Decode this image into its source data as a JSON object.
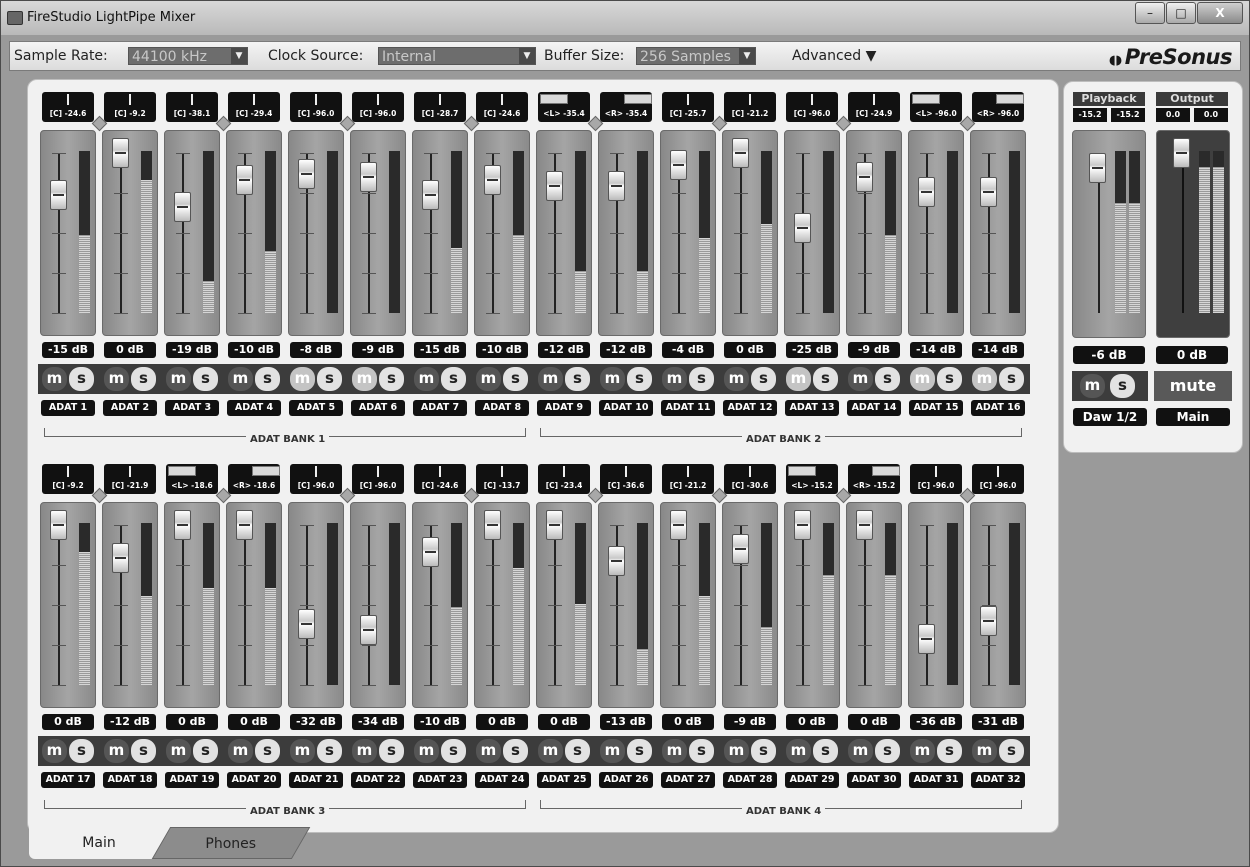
{
  "window": {
    "title": "FireStudio LightPipe Mixer",
    "minimize_label": "–",
    "maximize_label": "□",
    "close_label": "X"
  },
  "toolbar": {
    "sample_rate_label": "Sample Rate:",
    "sample_rate_value": "44100 kHz",
    "clock_source_label": "Clock Source:",
    "clock_source_value": "Internal",
    "buffer_size_label": "Buffer Size:",
    "buffer_size_value": "256 Samples",
    "advanced_label": "Advanced",
    "brand": "PreSonus"
  },
  "mute_label": "m",
  "solo_label": "s",
  "banks": [
    {
      "label": "ADAT BANK 1",
      "channels": [
        {
          "name": "ADAT 1",
          "pan": "[C] -24.6",
          "gain": "-15 dB",
          "level": 0.72,
          "meter": 0.48,
          "highlight": false
        },
        {
          "name": "ADAT 2",
          "pan": "[C] -9.2",
          "gain": "0 dB",
          "level": 1.0,
          "meter": 0.82,
          "highlight": false
        },
        {
          "name": "ADAT 3",
          "pan": "[C] -38.1",
          "gain": "-19 dB",
          "level": 0.64,
          "meter": 0.2,
          "highlight": false
        },
        {
          "name": "ADAT 4",
          "pan": "[C] -29.4",
          "gain": "-10 dB",
          "level": 0.82,
          "meter": 0.38,
          "highlight": false
        }
      ],
      "channels2": [
        {
          "name": "ADAT 5",
          "pan": "[C] -96.0",
          "gain": "-8 dB",
          "level": 0.86,
          "meter": 0.0,
          "highlight": true
        },
        {
          "name": "ADAT 6",
          "pan": "[C] -96.0",
          "gain": "-9 dB",
          "level": 0.84,
          "meter": 0.0,
          "highlight": true
        },
        {
          "name": "ADAT 7",
          "pan": "[C] -28.7",
          "gain": "-15 dB",
          "level": 0.72,
          "meter": 0.4,
          "highlight": false
        },
        {
          "name": "ADAT 8",
          "pan": "[C] -24.6",
          "gain": "-10 dB",
          "level": 0.82,
          "meter": 0.48,
          "highlight": false
        }
      ]
    },
    {
      "label": "ADAT BANK 2",
      "channels": [
        {
          "name": "ADAT 9",
          "pan": "<L> -35.4",
          "gain": "-12 dB",
          "level": 0.78,
          "meter": 0.26,
          "highlight": false,
          "stereo": "L"
        },
        {
          "name": "ADAT 10",
          "pan": "<R> -35.4",
          "gain": "-12 dB",
          "level": 0.78,
          "meter": 0.26,
          "highlight": false,
          "stereo": "R"
        },
        {
          "name": "ADAT 11",
          "pan": "[C] -25.7",
          "gain": "-4 dB",
          "level": 0.92,
          "meter": 0.46,
          "highlight": false
        },
        {
          "name": "ADAT 12",
          "pan": "[C] -21.2",
          "gain": "0 dB",
          "level": 1.0,
          "meter": 0.55,
          "highlight": false
        }
      ],
      "channels2": [
        {
          "name": "ADAT 13",
          "pan": "[C] -96.0",
          "gain": "-25 dB",
          "level": 0.5,
          "meter": 0.0,
          "highlight": true
        },
        {
          "name": "ADAT 14",
          "pan": "[C] -24.9",
          "gain": "-9 dB",
          "level": 0.84,
          "meter": 0.48,
          "highlight": false
        },
        {
          "name": "ADAT 15",
          "pan": "<L> -96.0",
          "gain": "-14 dB",
          "level": 0.74,
          "meter": 0.0,
          "highlight": true,
          "stereo": "L"
        },
        {
          "name": "ADAT 16",
          "pan": "<R> -96.0",
          "gain": "-14 dB",
          "level": 0.74,
          "meter": 0.0,
          "highlight": true,
          "stereo": "R"
        }
      ]
    },
    {
      "label": "ADAT BANK 3",
      "channels": [
        {
          "name": "ADAT 17",
          "pan": "[C] -9.2",
          "gain": "0 dB",
          "level": 1.0,
          "meter": 0.82,
          "highlight": false
        },
        {
          "name": "ADAT 18",
          "pan": "[C] -21.9",
          "gain": "-12 dB",
          "level": 0.78,
          "meter": 0.55,
          "highlight": false
        },
        {
          "name": "ADAT 19",
          "pan": "<L> -18.6",
          "gain": "0 dB",
          "level": 1.0,
          "meter": 0.6,
          "highlight": false,
          "stereo": "L"
        },
        {
          "name": "ADAT 20",
          "pan": "<R> -18.6",
          "gain": "0 dB",
          "level": 1.0,
          "meter": 0.6,
          "highlight": false,
          "stereo": "R"
        }
      ],
      "channels2": [
        {
          "name": "ADAT 21",
          "pan": "[C] -96.0",
          "gain": "-32 dB",
          "level": 0.34,
          "meter": 0.0,
          "highlight": false
        },
        {
          "name": "ADAT 22",
          "pan": "[C] -96.0",
          "gain": "-34 dB",
          "level": 0.3,
          "meter": 0.0,
          "highlight": false
        },
        {
          "name": "ADAT 23",
          "pan": "[C] -24.6",
          "gain": "-10 dB",
          "level": 0.82,
          "meter": 0.48,
          "highlight": false
        },
        {
          "name": "ADAT 24",
          "pan": "[C] -13.7",
          "gain": "0 dB",
          "level": 1.0,
          "meter": 0.72,
          "highlight": false
        }
      ]
    },
    {
      "label": "ADAT BANK 4",
      "channels": [
        {
          "name": "ADAT 25",
          "pan": "[C] -23.4",
          "gain": "0 dB",
          "level": 1.0,
          "meter": 0.5,
          "highlight": false
        },
        {
          "name": "ADAT 26",
          "pan": "[C] -36.6",
          "gain": "-13 dB",
          "level": 0.76,
          "meter": 0.22,
          "highlight": false
        },
        {
          "name": "ADAT 27",
          "pan": "[C] -21.2",
          "gain": "0 dB",
          "level": 1.0,
          "meter": 0.55,
          "highlight": false
        },
        {
          "name": "ADAT 28",
          "pan": "[C] -30.6",
          "gain": "-9 dB",
          "level": 0.84,
          "meter": 0.36,
          "highlight": false
        }
      ],
      "channels2": [
        {
          "name": "ADAT 29",
          "pan": "<L> -15.2",
          "gain": "0 dB",
          "level": 1.0,
          "meter": 0.68,
          "highlight": false,
          "stereo": "L"
        },
        {
          "name": "ADAT 30",
          "pan": "<R> -15.2",
          "gain": "0 dB",
          "level": 1.0,
          "meter": 0.68,
          "highlight": false,
          "stereo": "R"
        },
        {
          "name": "ADAT 31",
          "pan": "[C] -96.0",
          "gain": "-36 dB",
          "level": 0.24,
          "meter": 0.0,
          "highlight": false
        },
        {
          "name": "ADAT 32",
          "pan": "[C] -96.0",
          "gain": "-31 dB",
          "level": 0.36,
          "meter": 0.0,
          "highlight": false
        }
      ]
    }
  ],
  "playback": {
    "label": "Playback",
    "left_value": "-15.2",
    "right_value": "-15.2",
    "gain": "-6 dB",
    "name": "Daw 1/2",
    "level": 0.9,
    "meter_l": 0.68,
    "meter_r": 0.68
  },
  "output": {
    "label": "Output",
    "left_value": "0.0",
    "right_value": "0.0",
    "gain": "0 dB",
    "name": "Main",
    "mute_label": "mute",
    "level": 1.0,
    "meter_l": 0.9,
    "meter_r": 0.9
  },
  "tabs": {
    "main": "Main",
    "phones": "Phones"
  }
}
